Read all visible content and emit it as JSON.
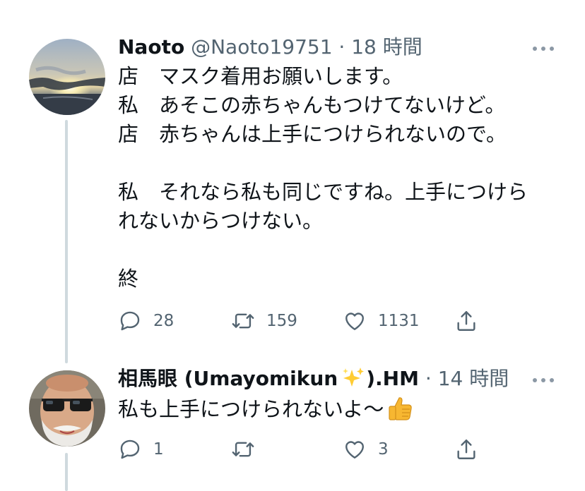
{
  "tweets": [
    {
      "name": "Naoto",
      "handle": "@Naoto19751",
      "separator": "·",
      "time": "18 時間",
      "lines": [
        "店　マスク着用お願いします。",
        "私　あそこの赤ちゃんもつけてないけど。",
        "店　赤ちゃんは上手につけられないので。",
        "",
        "私　それなら私も同じですね。上手につけら",
        "れないからつけない。",
        "",
        "終"
      ],
      "replies": "28",
      "retweets": "159",
      "likes": "1131"
    },
    {
      "name": "相馬眼 (Umayomikun",
      "name_emoji": "sparkles-emoji",
      "name_suffix": ").HM",
      "separator": "·",
      "time": "14 時間",
      "text": "私も上手につけられないよ〜",
      "text_emoji": "thumbs-up-emoji",
      "replies": "1",
      "retweets": "",
      "likes": "3"
    }
  ],
  "icons": {
    "reply": "reply-icon",
    "retweet": "retweet-icon",
    "like": "like-icon",
    "share": "share-icon",
    "more": "more-icon"
  },
  "colors": {
    "secondary_text": "#536471",
    "thread_line": "#cfd9de",
    "icon": "#536471"
  }
}
